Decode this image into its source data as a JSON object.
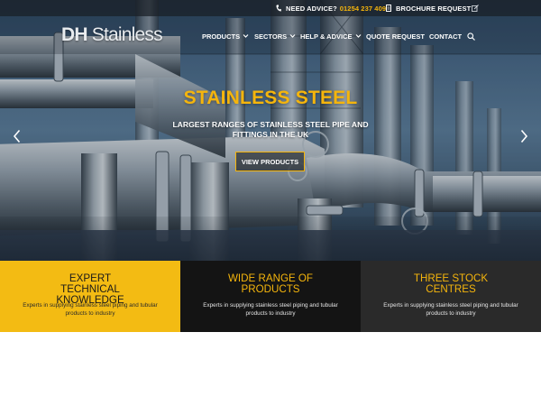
{
  "topbar": {
    "need_advice_label": "NEED ADVICE?",
    "phone": "01254 237 409",
    "brochure_label": "BROCHURE REQUEST",
    "icons": [
      "phone-icon",
      "document-icon",
      "edit-icon"
    ]
  },
  "header": {
    "logo_bold": "DH",
    "logo_rest": "Stainless",
    "nav": [
      {
        "label": "PRODUCTS",
        "dropdown": true
      },
      {
        "label": "SECTORS",
        "dropdown": true
      },
      {
        "label": "HELP & ADVICE",
        "dropdown": true
      },
      {
        "label": "QUOTE REQUEST",
        "dropdown": false
      },
      {
        "label": "CONTACT",
        "dropdown": false
      }
    ],
    "search_icon": "search-icon"
  },
  "hero": {
    "title": "STAINLESS STEEL",
    "subtitle": "LARGEST RANGES OF STAINLESS STEEL PIPE AND FITTINGS IN THE UK",
    "cta": "VIEW PRODUCTS",
    "arrows": [
      "chevron-left-icon",
      "chevron-right-icon"
    ]
  },
  "features": [
    {
      "title": "EXPERT TECHNICAL KNOWLEDGE",
      "text": "Experts in supplying stainless steel piping and tubular products to industry"
    },
    {
      "title": "WIDE RANGE OF PRODUCTS",
      "text": "Experts in supplying stainless steel piping and tubular products to industry"
    },
    {
      "title": "THREE STOCK CENTRES",
      "text": "Experts in supplying stainless steel piping and tubular products to industry"
    }
  ],
  "colors": {
    "accent": "#f5b50c",
    "panel_yellow": "#f3bb13",
    "panel_black": "#141414",
    "panel_dark": "#2a2a2a",
    "topbar": "#191f26"
  }
}
